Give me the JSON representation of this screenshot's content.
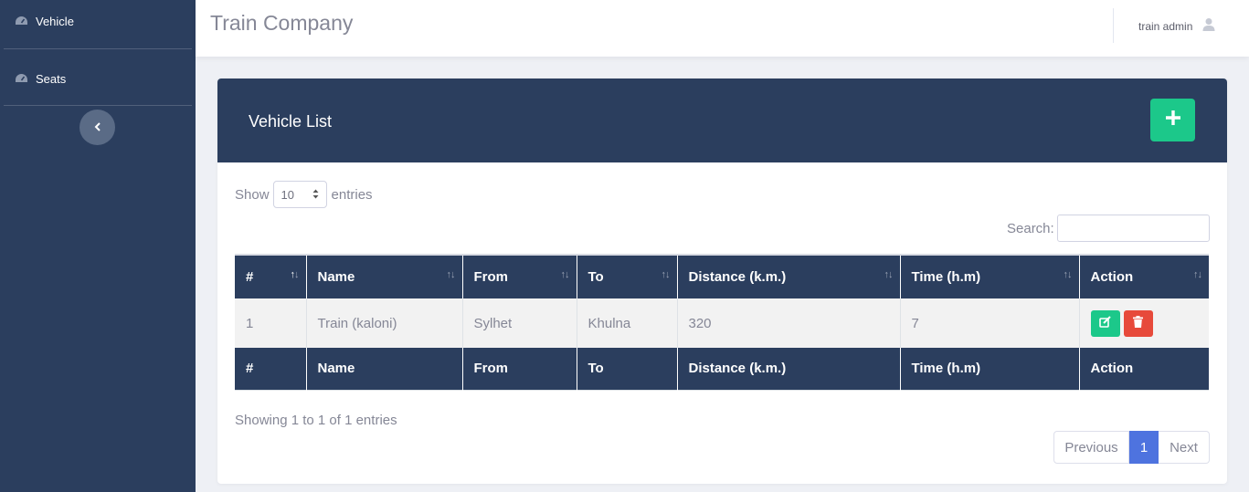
{
  "sidebar": {
    "items": [
      {
        "label": "Vehicle",
        "icon": "dashboard-icon"
      },
      {
        "label": "Seats",
        "icon": "dashboard-icon"
      }
    ],
    "toggle_icon": "chevron-left-icon"
  },
  "topbar": {
    "brand": "Train Company",
    "user_name": "train admin",
    "user_icon": "user-icon"
  },
  "card": {
    "title": "Vehicle List",
    "add_icon": "plus-icon"
  },
  "length_menu": {
    "show_label": "Show",
    "value": "10",
    "entries_label": "entries"
  },
  "search": {
    "label": "Search:",
    "value": ""
  },
  "table": {
    "columns": [
      "#",
      "Name",
      "From",
      "To",
      "Distance (k.m.)",
      "Time (h.m)",
      "Action"
    ],
    "rows": [
      {
        "num": "1",
        "name": "Train (kaloni)",
        "from": "Sylhet",
        "to": "Khulna",
        "distance": "320",
        "time": "7"
      }
    ],
    "row_actions": [
      "edit-icon",
      "trash-icon"
    ]
  },
  "footer": {
    "info": "Showing 1 to 1 of 1 entries",
    "prev": "Previous",
    "current_page": "1",
    "next": "Next"
  },
  "colors": {
    "navy": "#2b3e5e",
    "success": "#1cc88a",
    "danger": "#e74a3b",
    "primary": "#4e73df"
  }
}
